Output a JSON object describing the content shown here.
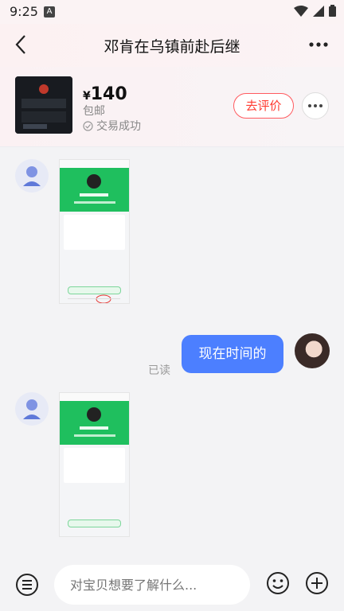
{
  "status": {
    "time": "9:25",
    "notif_icon": "A"
  },
  "header": {
    "title": "邓肯在乌镇前赴后继"
  },
  "product": {
    "price": "140",
    "currency": "¥",
    "shipping": "包邮",
    "deal_status": "交易成功",
    "rate_button": "去评价"
  },
  "messages": [
    {
      "type": "image",
      "from": "other"
    },
    {
      "type": "text",
      "from": "me",
      "text": "现在时间的",
      "read": "已读"
    },
    {
      "type": "image",
      "from": "other"
    }
  ],
  "input": {
    "placeholder": "对宝贝想要了解什么..."
  },
  "colors": {
    "accent": "#4c7fff",
    "rate": "#ff3b30",
    "green": "#1fbf5e"
  }
}
